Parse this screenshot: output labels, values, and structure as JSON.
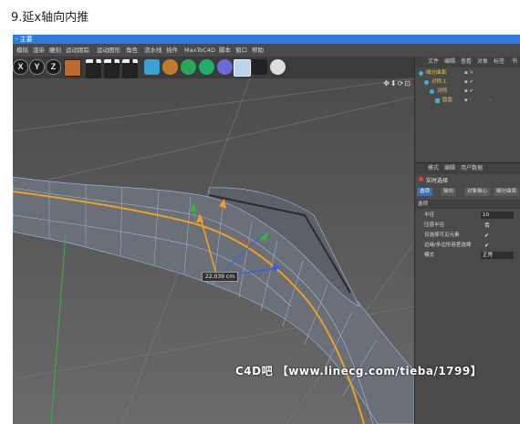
{
  "caption": "9.延x轴向内推",
  "app": {
    "title": "- 主要",
    "menu": [
      "模拟",
      "渲染",
      "雕刻",
      "运动跟踪",
      "运动图形",
      "角色",
      "流水线",
      "插件",
      "MaxToC4D",
      "脚本",
      "窗口",
      "帮助"
    ],
    "axis_buttons": [
      "X",
      "Y",
      "Z"
    ],
    "viewport_nav": "✥⬇⟳⊡",
    "measure_label": "22.039 cm"
  },
  "object_manager": {
    "menu": [
      "文件",
      "编辑",
      "查看",
      "对象",
      "标签",
      "书"
    ],
    "objects": [
      {
        "name": "细分曲面",
        "color": "#e8c33a"
      },
      {
        "name": "对称.1",
        "color": "#e8c33a"
      },
      {
        "name": "对称",
        "color": "#e8c33a"
      },
      {
        "name": "圆盘",
        "color": "#e8c33a"
      }
    ]
  },
  "attributes": {
    "menu": [
      "模式",
      "编辑",
      "用户数据"
    ],
    "tool_title": "实时选择",
    "tabs": [
      "选项",
      "轴向",
      "对象轴心",
      "细分曲面"
    ],
    "active_tab": "选项",
    "section": "选项",
    "rows": [
      {
        "label": "半径",
        "value": "10"
      },
      {
        "label": "压感半径",
        "value": "否"
      },
      {
        "label": "仅选择可见元素",
        "value": "✔"
      },
      {
        "label": "边缘/多边形容差选择",
        "value": "✔"
      },
      {
        "label": "模式",
        "value": "正常"
      }
    ]
  },
  "watermark": "C4D吧 【www.linecg.com/tieba/1799】"
}
